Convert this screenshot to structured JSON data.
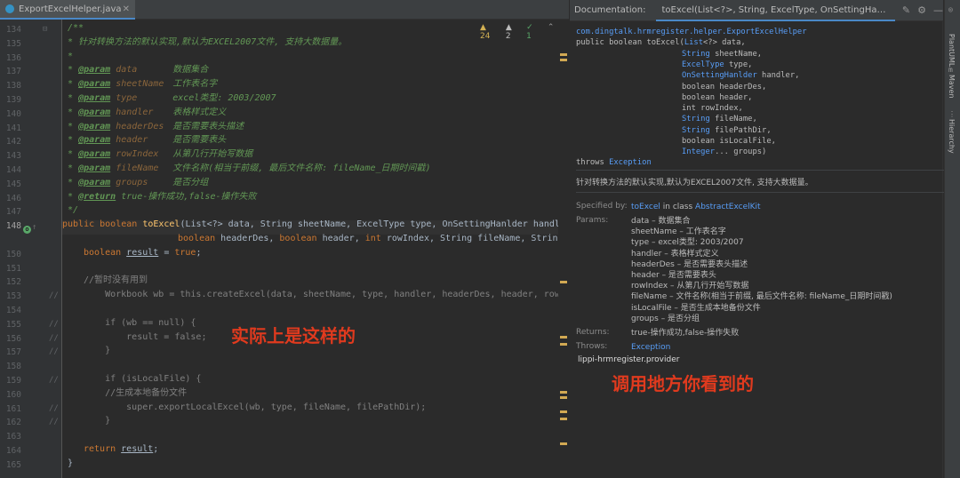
{
  "editor": {
    "tab_label": "ExportExcelHelper.java",
    "inspections": {
      "warnings": "24",
      "weak": "2",
      "ok": "1"
    },
    "gutter_lines": [
      "134",
      "135",
      "136",
      "137",
      "138",
      "139",
      "140",
      "141",
      "142",
      "143",
      "144",
      "145",
      "146",
      "147",
      "148",
      "",
      "150",
      "151",
      "152",
      "153",
      "154",
      "155",
      "156",
      "157",
      "158",
      "159",
      "160",
      "161",
      "162",
      "163",
      "164",
      "165"
    ],
    "current_line": "148",
    "javadoc": {
      "open": "/**",
      "desc": "* 针对转换方法的默认实现,默认为EXCEL2007文件, 支持大数据量。",
      "star": "*",
      "params": [
        {
          "tag": "@param",
          "name": "data",
          "text": "数据集合"
        },
        {
          "tag": "@param",
          "name": "sheetName",
          "text": "工作表名字"
        },
        {
          "tag": "@param",
          "name": "type",
          "text": "excel类型: 2003/2007"
        },
        {
          "tag": "@param",
          "name": "handler",
          "text": "表格样式定义"
        },
        {
          "tag": "@param",
          "name": "headerDes",
          "text": "是否需要表头描述"
        },
        {
          "tag": "@param",
          "name": "header",
          "text": "是否需要表头"
        },
        {
          "tag": "@param",
          "name": "rowIndex",
          "text": "从第几行开始写数据"
        },
        {
          "tag": "@param",
          "name": "fileName",
          "text": "文件名称(相当于前缀, 最后文件名称: fileName_日期时间戳)"
        },
        {
          "tag": "@param",
          "name": "groups",
          "text": "是否分组"
        }
      ],
      "return": {
        "tag": "@return",
        "text": "true-操作成功,false-操作失败"
      },
      "close": "*/"
    },
    "code": {
      "sig_kw": "public boolean ",
      "sig_fn": "toExcel",
      "sig_rest": "(List<?> data, String sheetName, ExcelType type, OnSettingHanlder handler,",
      "sig2_a": "boolean",
      "sig2_b": " headerDes, ",
      "sig2_c": "boolean",
      "sig2_d": " header, ",
      "sig2_e": "int",
      "sig2_f": " rowIndex, String fileName, String file",
      "l150_kw": "boolean ",
      "l150_var": "result",
      "l150_eq": " = ",
      "l150_val": "true",
      "l150_end": ";",
      "l152": "//暂时没有用到",
      "l153": "    Workbook wb = this.createExcel(data, sheetName, type, handler, headerDes, header, rowIndex, gr",
      "l155": "    if (wb == null) {",
      "l156": "        result = false;",
      "l157": "    }",
      "l159": "    if (isLocalFile) {",
      "l160": "    //生成本地备份文件",
      "l161": "        super.exportLocalExcel(wb, type, fileName, filePathDir);",
      "l162": "    }",
      "l164_kw": "return ",
      "l164_var": "result",
      "l164_end": ";",
      "l165": "}"
    },
    "annotation": "实际上是这样的"
  },
  "doc": {
    "label": "Documentation:",
    "tab": "toExcel(List<?>, String, ExcelType, OnSettingHanlder, b...",
    "package": "com.dingtalk.hrmregister.helper.ExportExcelHelper",
    "sig_head": "public boolean toExcel(",
    "sig_head_link": "List",
    "sig_head_tail": "<?> data,",
    "sig_params": [
      {
        "link": "String",
        "rest": " sheetName,"
      },
      {
        "link": "ExcelType",
        "rest": " type,"
      },
      {
        "link": "OnSettingHanlder",
        "rest": " handler,"
      },
      {
        "link": "",
        "rest": "boolean headerDes,"
      },
      {
        "link": "",
        "rest": "boolean header,"
      },
      {
        "link": "",
        "rest": "int rowIndex,"
      },
      {
        "link": "String",
        "rest": " fileName,"
      },
      {
        "link": "String",
        "rest": " filePathDir,"
      },
      {
        "link": "",
        "rest": "boolean isLocalFile,"
      },
      {
        "link": "Integer",
        "rest": "... groups)"
      }
    ],
    "throws_kw": "throws ",
    "throws_link": "Exception",
    "description": "针对转换方法的默认实现,默认为EXCEL2007文件, 支持大数据量。",
    "specified_label": "Specified by:",
    "specified_link": "toExcel",
    "specified_mid": " in class ",
    "specified_class": "AbstractExcelKit",
    "params_label": "Params:",
    "params": [
      "data – 数据集合",
      "sheetName – 工作表名字",
      "type – excel类型: 2003/2007",
      "handler – 表格样式定义",
      "headerDes – 是否需要表头描述",
      "header – 是否需要表头",
      "rowIndex – 从第几行开始写数据",
      "fileName – 文件名称(相当于前缀, 最后文件名称: fileName_日期时间戳)",
      "isLocalFile – 是否生成本地备份文件",
      "groups – 是否分组"
    ],
    "returns_label": "Returns:",
    "returns_text": "true-操作成功,false-操作失败",
    "throws_label": "Throws:",
    "throws_val": "Exception",
    "provider": "lippi-hrmregister.provider",
    "annotation": "调用地方你看到的"
  },
  "toolstrip": {
    "tabs": [
      "PlantUML",
      "Maven",
      "Hierarchy"
    ]
  }
}
